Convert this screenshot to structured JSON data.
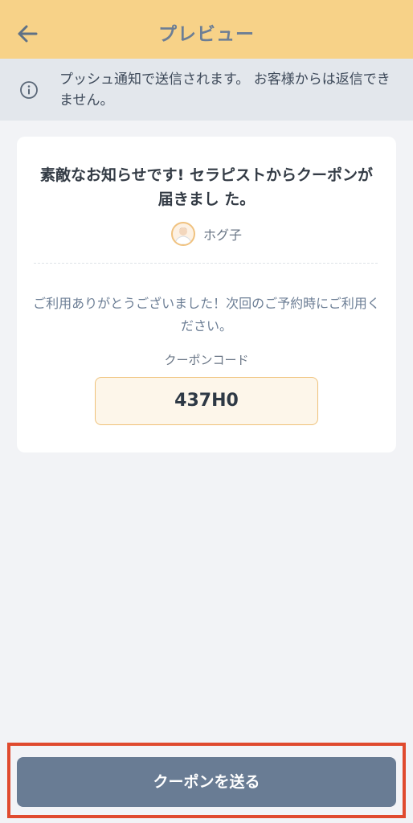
{
  "header": {
    "title": "プレビュー",
    "back_icon": "arrow-left-icon"
  },
  "notice": {
    "icon": "info-icon",
    "text": "プッシュ通知で送信されます。 お客様からは返信できません。"
  },
  "card": {
    "title": "素敵なお知らせです! セラピストからクーポンが届きまし た。",
    "sender_name": "ホグ子",
    "message": "ご利用ありがとうございました！次回のご予約時にご利用ください。",
    "coupon_label": "クーポンコード",
    "coupon_code": "437H0"
  },
  "footer": {
    "send_label": "クーポンを送る"
  },
  "colors": {
    "header_bg": "#f7d288",
    "accent_title": "#6c7e95",
    "button_bg": "#697c94",
    "highlight": "#e04a2e",
    "code_border": "#efc27a"
  }
}
